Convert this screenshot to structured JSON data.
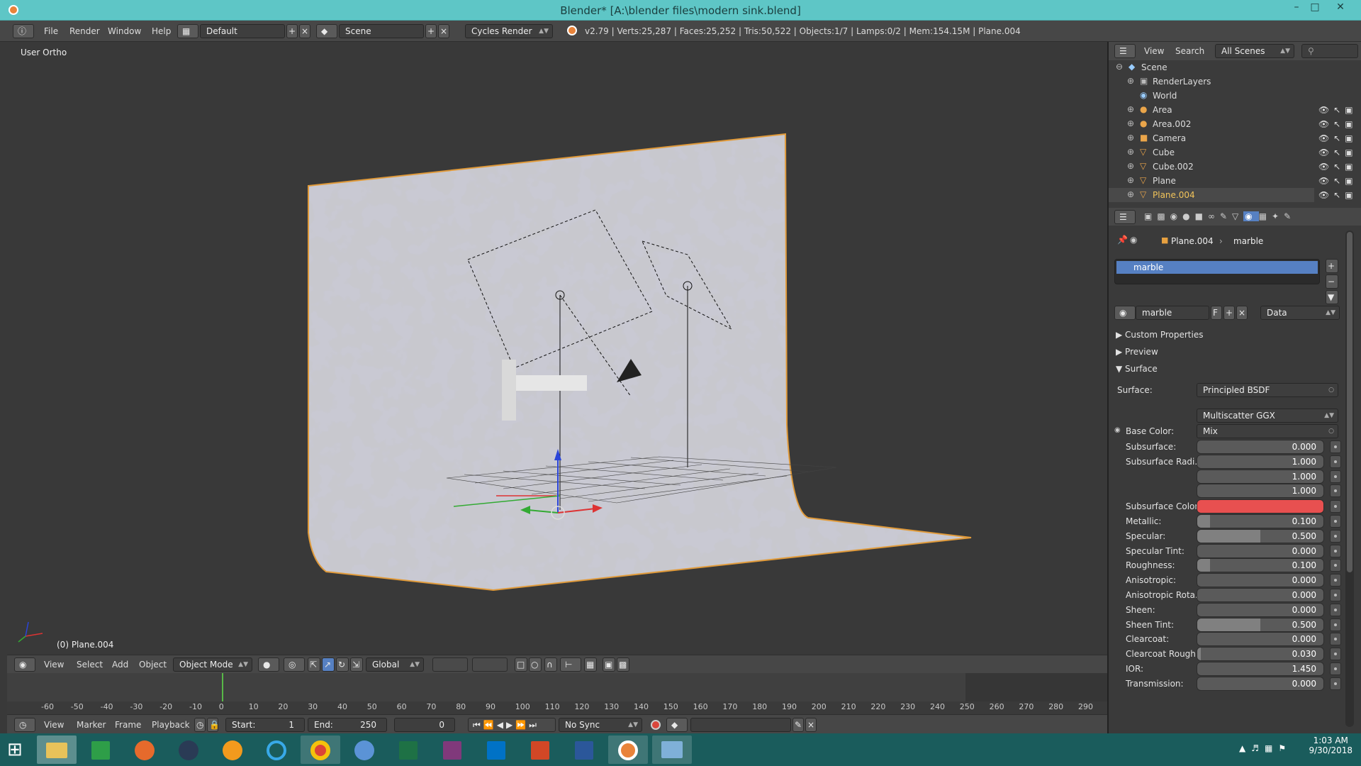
{
  "window": {
    "title": "Blender* [A:\\blender files\\modern sink.blend]"
  },
  "menubar": {
    "items": [
      "File",
      "Render",
      "Window",
      "Help"
    ],
    "screen_layout": "Default",
    "scene": "Scene",
    "render_engine": "Cycles Render",
    "stats": "v2.79 | Verts:25,287 | Faces:25,252 | Tris:50,522 | Objects:1/7 | Lamps:0/2 | Mem:154.15M | Plane.004"
  },
  "viewport": {
    "view_label": "User Ortho",
    "object_label": "(0) Plane.004"
  },
  "view3d_header": {
    "menus": [
      "View",
      "Select",
      "Add",
      "Object"
    ],
    "mode": "Object Mode",
    "orientation": "Global"
  },
  "timeline": {
    "ticks": [
      "-60",
      "-50",
      "-40",
      "-30",
      "-20",
      "-10",
      "0",
      "10",
      "20",
      "30",
      "40",
      "50",
      "60",
      "70",
      "80",
      "90",
      "100",
      "110",
      "120",
      "130",
      "140",
      "150",
      "160",
      "170",
      "180",
      "190",
      "200",
      "210",
      "220",
      "230",
      "240",
      "250",
      "260",
      "270",
      "280",
      "290"
    ],
    "menus": [
      "View",
      "Marker",
      "Frame",
      "Playback"
    ],
    "start_label": "Start:",
    "start_value": "1",
    "end_label": "End:",
    "end_value": "250",
    "current_frame": "0",
    "sync": "No Sync"
  },
  "outliner": {
    "menus": [
      "View",
      "Search"
    ],
    "scene_filter": "All Scenes",
    "items": [
      {
        "label": "Scene"
      },
      {
        "label": "RenderLayers"
      },
      {
        "label": "World"
      },
      {
        "label": "Area"
      },
      {
        "label": "Area.002"
      },
      {
        "label": "Camera"
      },
      {
        "label": "Cube"
      },
      {
        "label": "Cube.002"
      },
      {
        "label": "Plane"
      },
      {
        "label": "Plane.004"
      }
    ]
  },
  "properties": {
    "breadcrumb": [
      "Plane.004",
      "marble"
    ],
    "material_slot": "marble",
    "material_name": "marble",
    "fake_user": "F",
    "link": "Data",
    "panels": [
      "Custom Properties",
      "Preview",
      "Surface"
    ],
    "surface_label": "Surface:",
    "surface_shader": "Principled BSDF",
    "distribution": "Multiscatter GGX",
    "base_color_label": "Base Color:",
    "base_color_value": "Mix",
    "fields": [
      {
        "label": "Subsurface:",
        "value": "0.000",
        "fill": 0.0
      },
      {
        "label": "Subsurface Radi...",
        "value": "1.000",
        "fill": 0.0
      },
      {
        "label": "",
        "value": "1.000",
        "fill": 0.0
      },
      {
        "label": "",
        "value": "1.000",
        "fill": 0.0
      },
      {
        "label": "Subsurface Color:",
        "value": "",
        "color": "#e85050"
      },
      {
        "label": "Metallic:",
        "value": "0.100",
        "fill": 0.1
      },
      {
        "label": "Specular:",
        "value": "0.500",
        "fill": 0.5
      },
      {
        "label": "Specular Tint:",
        "value": "0.000",
        "fill": 0.0
      },
      {
        "label": "Roughness:",
        "value": "0.100",
        "fill": 0.1
      },
      {
        "label": "Anisotropic:",
        "value": "0.000",
        "fill": 0.0
      },
      {
        "label": "Anisotropic Rota...",
        "value": "0.000",
        "fill": 0.0
      },
      {
        "label": "Sheen:",
        "value": "0.000",
        "fill": 0.0
      },
      {
        "label": "Sheen Tint:",
        "value": "0.500",
        "fill": 0.5
      },
      {
        "label": "Clearcoat:",
        "value": "0.000",
        "fill": 0.0
      },
      {
        "label": "Clearcoat Rough...",
        "value": "0.030",
        "fill": 0.03
      },
      {
        "label": "IOR:",
        "value": "1.450",
        "fill": 0.0
      },
      {
        "label": "Transmission:",
        "value": "0.000",
        "fill": 0.0
      }
    ]
  },
  "taskbar": {
    "time": "1:03 AM",
    "date": "9/30/2018"
  }
}
